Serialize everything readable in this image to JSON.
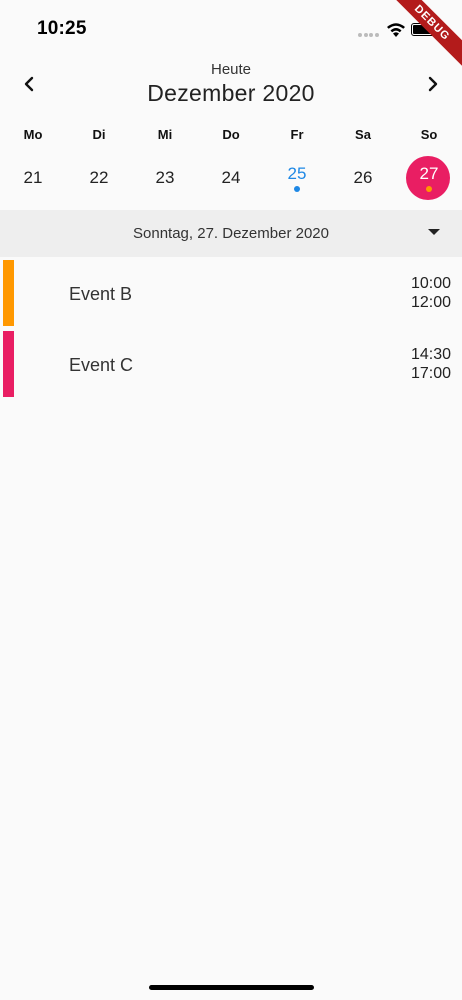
{
  "status_bar": {
    "time": "10:25",
    "icons": [
      "signal-icon",
      "wifi-icon",
      "battery-icon"
    ]
  },
  "debug_banner": "DEBUG",
  "header": {
    "today_label": "Heute",
    "month_title": "Dezember 2020",
    "prev_icon": "chevron-left-icon",
    "next_icon": "chevron-right-icon"
  },
  "weekdays": [
    "Mo",
    "Di",
    "Mi",
    "Do",
    "Fr",
    "Sa",
    "So"
  ],
  "days": [
    {
      "number": "21",
      "state": "normal"
    },
    {
      "number": "22",
      "state": "normal"
    },
    {
      "number": "23",
      "state": "normal"
    },
    {
      "number": "24",
      "state": "normal"
    },
    {
      "number": "25",
      "state": "today",
      "dot_color": "#1e88e5"
    },
    {
      "number": "26",
      "state": "normal"
    },
    {
      "number": "27",
      "state": "selected",
      "dot_color": "#ff9800"
    }
  ],
  "selected_date": {
    "label": "Sonntag, 27. Dezember 2020",
    "icon": "dropdown-arrow-icon"
  },
  "events": [
    {
      "title": "Event B",
      "start": "10:00",
      "end": "12:00",
      "color": "#ff9800"
    },
    {
      "title": "Event C",
      "start": "14:30",
      "end": "17:00",
      "color": "#e91e63"
    }
  ],
  "colors": {
    "today": "#1e88e5",
    "selected": "#e91e63",
    "date_bar_background": "#eeeeee"
  }
}
